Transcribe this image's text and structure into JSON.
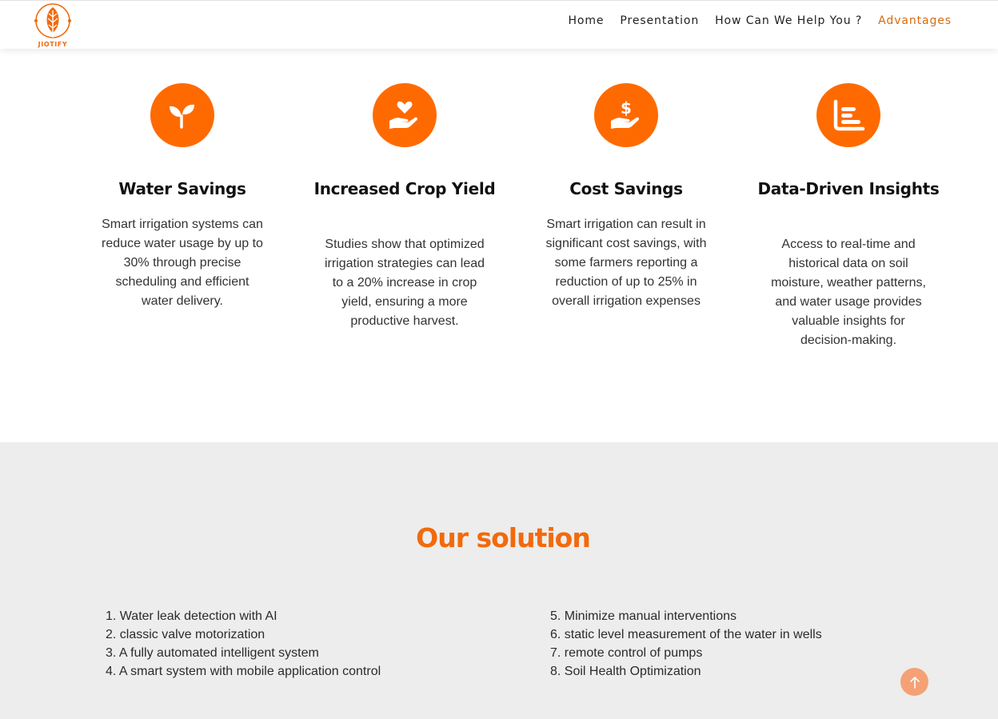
{
  "brand": {
    "name": "JIOTIFY",
    "accent": "#f26a0c",
    "icon_bg": "#ff6a00"
  },
  "nav": {
    "items": [
      {
        "label": "Home"
      },
      {
        "label": "Presentation"
      },
      {
        "label": "How Can We Help You ?"
      },
      {
        "label": "Advantages",
        "active": true
      }
    ]
  },
  "advantages": [
    {
      "icon": "sprout-icon",
      "title": "Water Savings",
      "text": "Smart irrigation systems can reduce water usage by up to 30% through precise scheduling and efficient water delivery."
    },
    {
      "icon": "hand-heart-icon",
      "title": "Increased Crop Yield",
      "text": "Studies show that optimized irrigation strategies can lead to a 20% increase in crop yield, ensuring a more productive harvest."
    },
    {
      "icon": "hand-dollar-icon",
      "title": "Cost Savings",
      "text": "Smart irrigation can result in significant cost savings, with some farmers reporting a reduction of up to 25% in overall irrigation expenses"
    },
    {
      "icon": "chart-icon",
      "title": "Data-Driven Insights",
      "text": "Access to real-time and historical data on soil moisture, weather patterns, and water usage provides valuable insights for decision-making."
    }
  ],
  "solution": {
    "title": "Our solution",
    "left": [
      "1. Water leak detection with AI",
      "2. classic valve motorization",
      "3. A fully automated intelligent system",
      "4. A smart system with mobile application control"
    ],
    "right": [
      "5. Minimize manual interventions",
      "6. static level measurement of the water in wells",
      "7. remote control of pumps",
      "8. Soil Health Optimization"
    ]
  },
  "scroll_top": {
    "icon": "arrow-up-icon"
  }
}
